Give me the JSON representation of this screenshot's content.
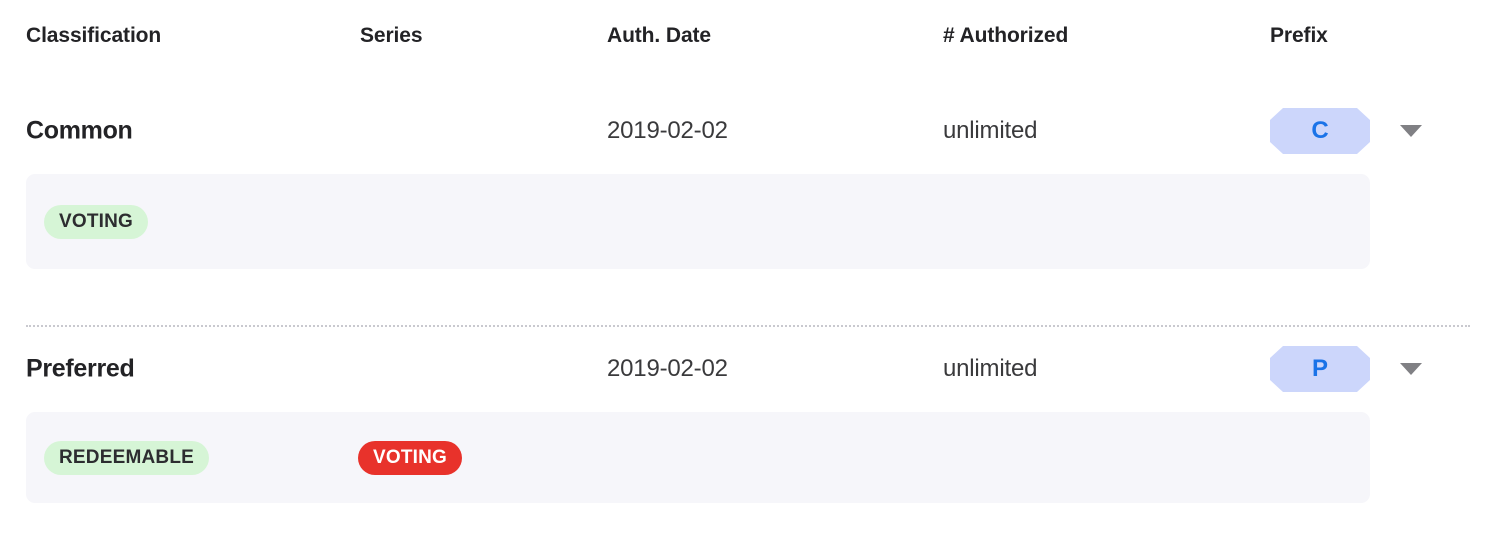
{
  "table": {
    "columns": [
      {
        "key": "classification",
        "label": "Classification"
      },
      {
        "key": "series",
        "label": "Series"
      },
      {
        "key": "auth_date",
        "label": "Auth. Date"
      },
      {
        "key": "num_authorized",
        "label": "# Authorized"
      },
      {
        "key": "prefix",
        "label": "Prefix"
      }
    ],
    "rows": [
      {
        "classification": "Common",
        "series": "",
        "auth_date": "2019-02-02",
        "num_authorized": "unlimited",
        "prefix": "C",
        "expand_icon": "caret-down-icon",
        "tags": [
          {
            "label": "VOTING",
            "style": "green",
            "column": "classification"
          }
        ]
      },
      {
        "classification": "Preferred",
        "series": "",
        "auth_date": "2019-02-02",
        "num_authorized": "unlimited",
        "prefix": "P",
        "expand_icon": "caret-down-icon",
        "tags": [
          {
            "label": "REDEEMABLE",
            "style": "green",
            "column": "classification"
          },
          {
            "label": "VOTING",
            "style": "red",
            "column": "series"
          }
        ]
      }
    ]
  },
  "colors": {
    "header_text": "#232326",
    "body_text": "#3a3a3c",
    "prefix_badge_bg": "#ccd6fb",
    "prefix_badge_text": "#1a73e8",
    "tag_green_bg": "#d6f5d6",
    "tag_green_text": "#2d2d30",
    "tag_red_bg": "#e8322b",
    "tag_red_text": "#ffffff",
    "tag_panel_bg": "#f6f6fa",
    "divider": "#c9c9cf",
    "caret": "#808084"
  }
}
